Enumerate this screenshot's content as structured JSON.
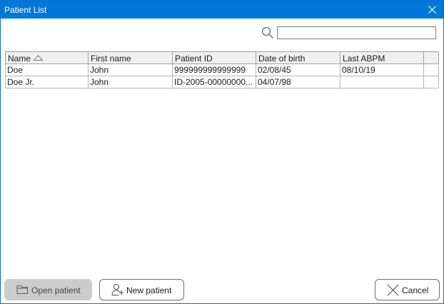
{
  "window": {
    "title": "Patient List"
  },
  "search": {
    "placeholder": "",
    "value": ""
  },
  "table": {
    "columns": [
      "Name",
      "First name",
      "Patient ID",
      "Date of birth",
      "Last ABPM",
      ""
    ],
    "sort": {
      "column": "Name",
      "direction": "ascending"
    },
    "rows": [
      [
        "Doe",
        "John",
        "999999999999999",
        "02/08/45",
        "08/10/19",
        ""
      ],
      [
        "Doe Jr.",
        "John",
        "ID-2005-00000000...",
        "04/07/98",
        "",
        ""
      ]
    ]
  },
  "buttons": {
    "open_label": "Open patient",
    "new_label": "New patient",
    "cancel_label": "Cancel"
  },
  "colors": {
    "titlebar": "#0078d7",
    "header_bg": "#f0f0f0",
    "disabled_button": "#cccccc"
  },
  "icons": [
    "close-icon",
    "search-icon",
    "sort-ascending-icon",
    "folder-icon",
    "add-user-icon",
    "cancel-x-icon"
  ]
}
